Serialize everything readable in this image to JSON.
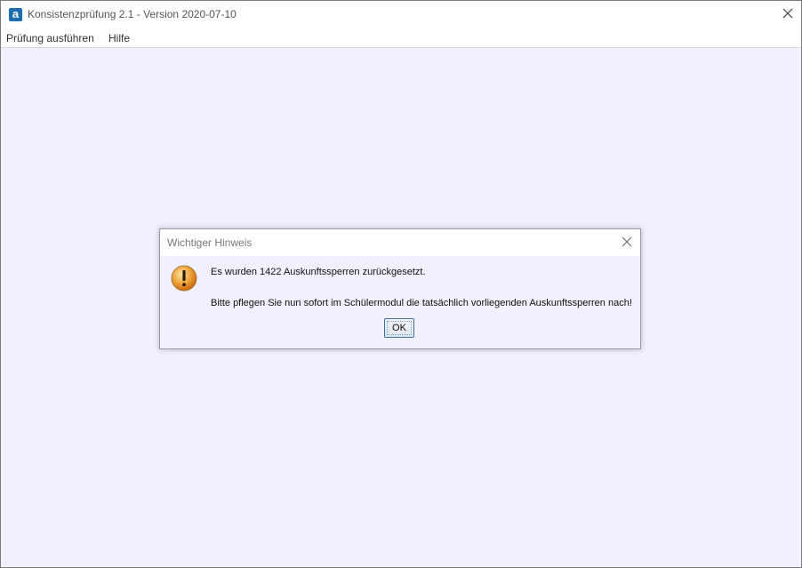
{
  "window": {
    "title": "Konsistenzprüfung 2.1 - Version 2020-07-10",
    "app_icon_glyph": "a"
  },
  "menu": {
    "items": [
      {
        "label": "Prüfung ausführen"
      },
      {
        "label": "Hilfe"
      }
    ]
  },
  "dialog": {
    "title": "Wichtiger Hinweis",
    "icon": "warning-icon",
    "message_line1": "Es wurden 1422 Auskunftssperren zurückgesetzt.",
    "message_line2": "Bitte pflegen Sie nun sofort im Schülermodul die tatsächlich vorliegenden Auskunftssperren nach!",
    "ok_label": "OK"
  },
  "colors": {
    "background": "#f0f0ff",
    "app_icon": "#1b6fb0",
    "warning_orange": "#e8952a"
  }
}
